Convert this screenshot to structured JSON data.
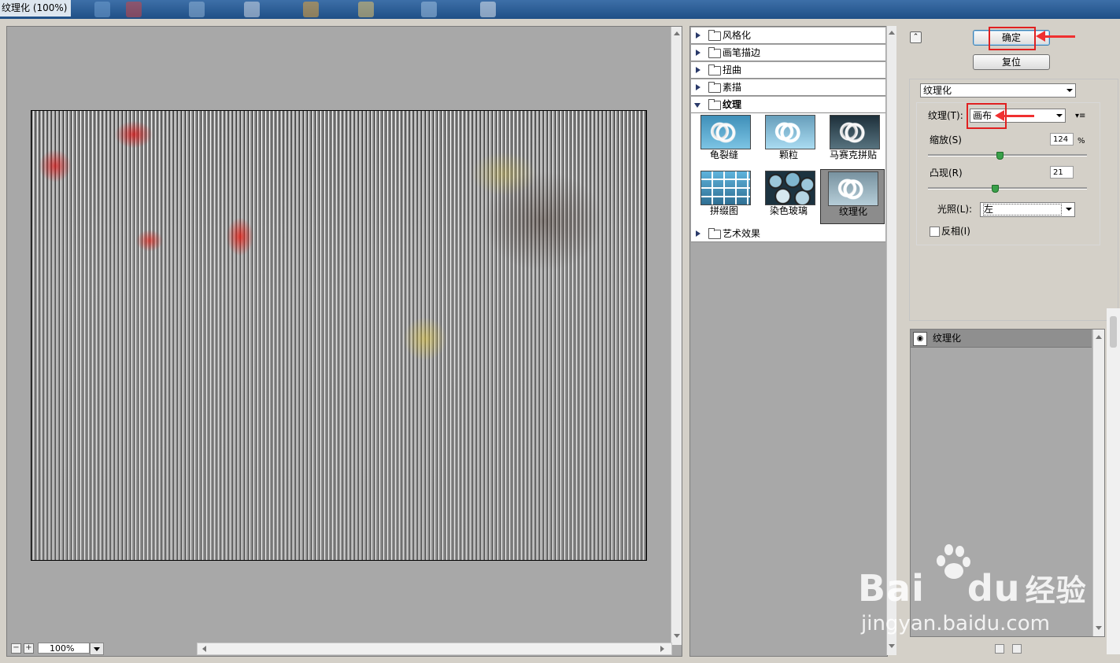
{
  "window": {
    "title": "纹理化 (100%)"
  },
  "preview": {
    "zoom": "100%"
  },
  "filter_gallery": {
    "categories_before": [
      "风格化",
      "画笔描边",
      "扭曲",
      "素描"
    ],
    "open_category": "纹理",
    "thumbnails": [
      "龟裂缝",
      "颗粒",
      "马赛克拼贴",
      "拼缀图",
      "染色玻璃",
      "纹理化"
    ],
    "selected_thumbnail": "纹理化",
    "categories_after": [
      "艺术效果"
    ]
  },
  "buttons": {
    "ok": "确定",
    "reset": "复位"
  },
  "options": {
    "filter_select": "纹理化",
    "texture_label": "纹理(T):",
    "texture_value": "画布",
    "scaling_label": "缩放(S)",
    "scaling_value": "124",
    "scaling_unit": "%",
    "scaling_fraction": 0.45,
    "relief_label": "凸现(R)",
    "relief_value": "21",
    "relief_fraction": 0.42,
    "light_label": "光照(L):",
    "light_value": "左",
    "invert_label": "反相(I)",
    "invert_checked": false
  },
  "layers": {
    "items": [
      "纹理化"
    ]
  },
  "watermark": {
    "brand": "Bai",
    "brand_suffix": "du",
    "brand_cn": "经验",
    "url": "jingyan.baidu.com"
  },
  "colors": {
    "highlight": "#e02020",
    "panel_gray": "#a8a8a8",
    "titlebar": "#2a5c94"
  }
}
